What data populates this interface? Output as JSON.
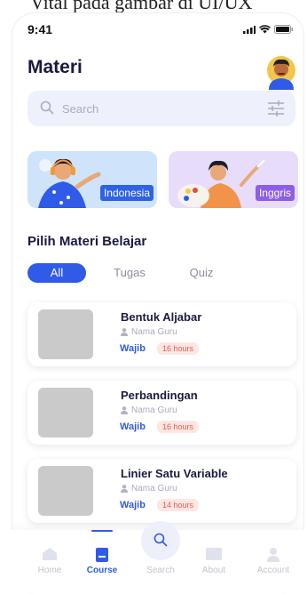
{
  "top_fragment": "Vital pada gambar di UI/UX",
  "status": {
    "time": "9:41"
  },
  "header": {
    "title": "Materi"
  },
  "search": {
    "placeholder": "Search"
  },
  "banners": [
    {
      "label": "Indonesia"
    },
    {
      "label": "Inggris"
    }
  ],
  "section": {
    "title": "Pilih Materi Belajar"
  },
  "tabs": [
    {
      "label": "All",
      "active": true
    },
    {
      "label": "Tugas",
      "active": false
    },
    {
      "label": "Quiz",
      "active": false
    }
  ],
  "items": [
    {
      "title": "Bentuk Aljabar",
      "teacher": "Nama Guru",
      "tag": "Wajib",
      "hours": "16 hours"
    },
    {
      "title": "Perbandingan",
      "teacher": "Nama Guru",
      "tag": "Wajib",
      "hours": "16 hours"
    },
    {
      "title": "Linier Satu Variable",
      "teacher": "Nama Guru",
      "tag": "Wajib",
      "hours": "14 hours"
    }
  ],
  "nav": [
    {
      "label": "Home",
      "icon": "home-icon"
    },
    {
      "label": "Course",
      "icon": "course-icon",
      "active": true
    },
    {
      "label": "Search",
      "icon": "search-icon"
    },
    {
      "label": "About",
      "icon": "about-icon"
    },
    {
      "label": "Account",
      "icon": "account-icon"
    }
  ],
  "colors": {
    "accent": "#2f5be8",
    "hours_text": "#ea5a4b",
    "hours_bg": "#fde7e3"
  }
}
